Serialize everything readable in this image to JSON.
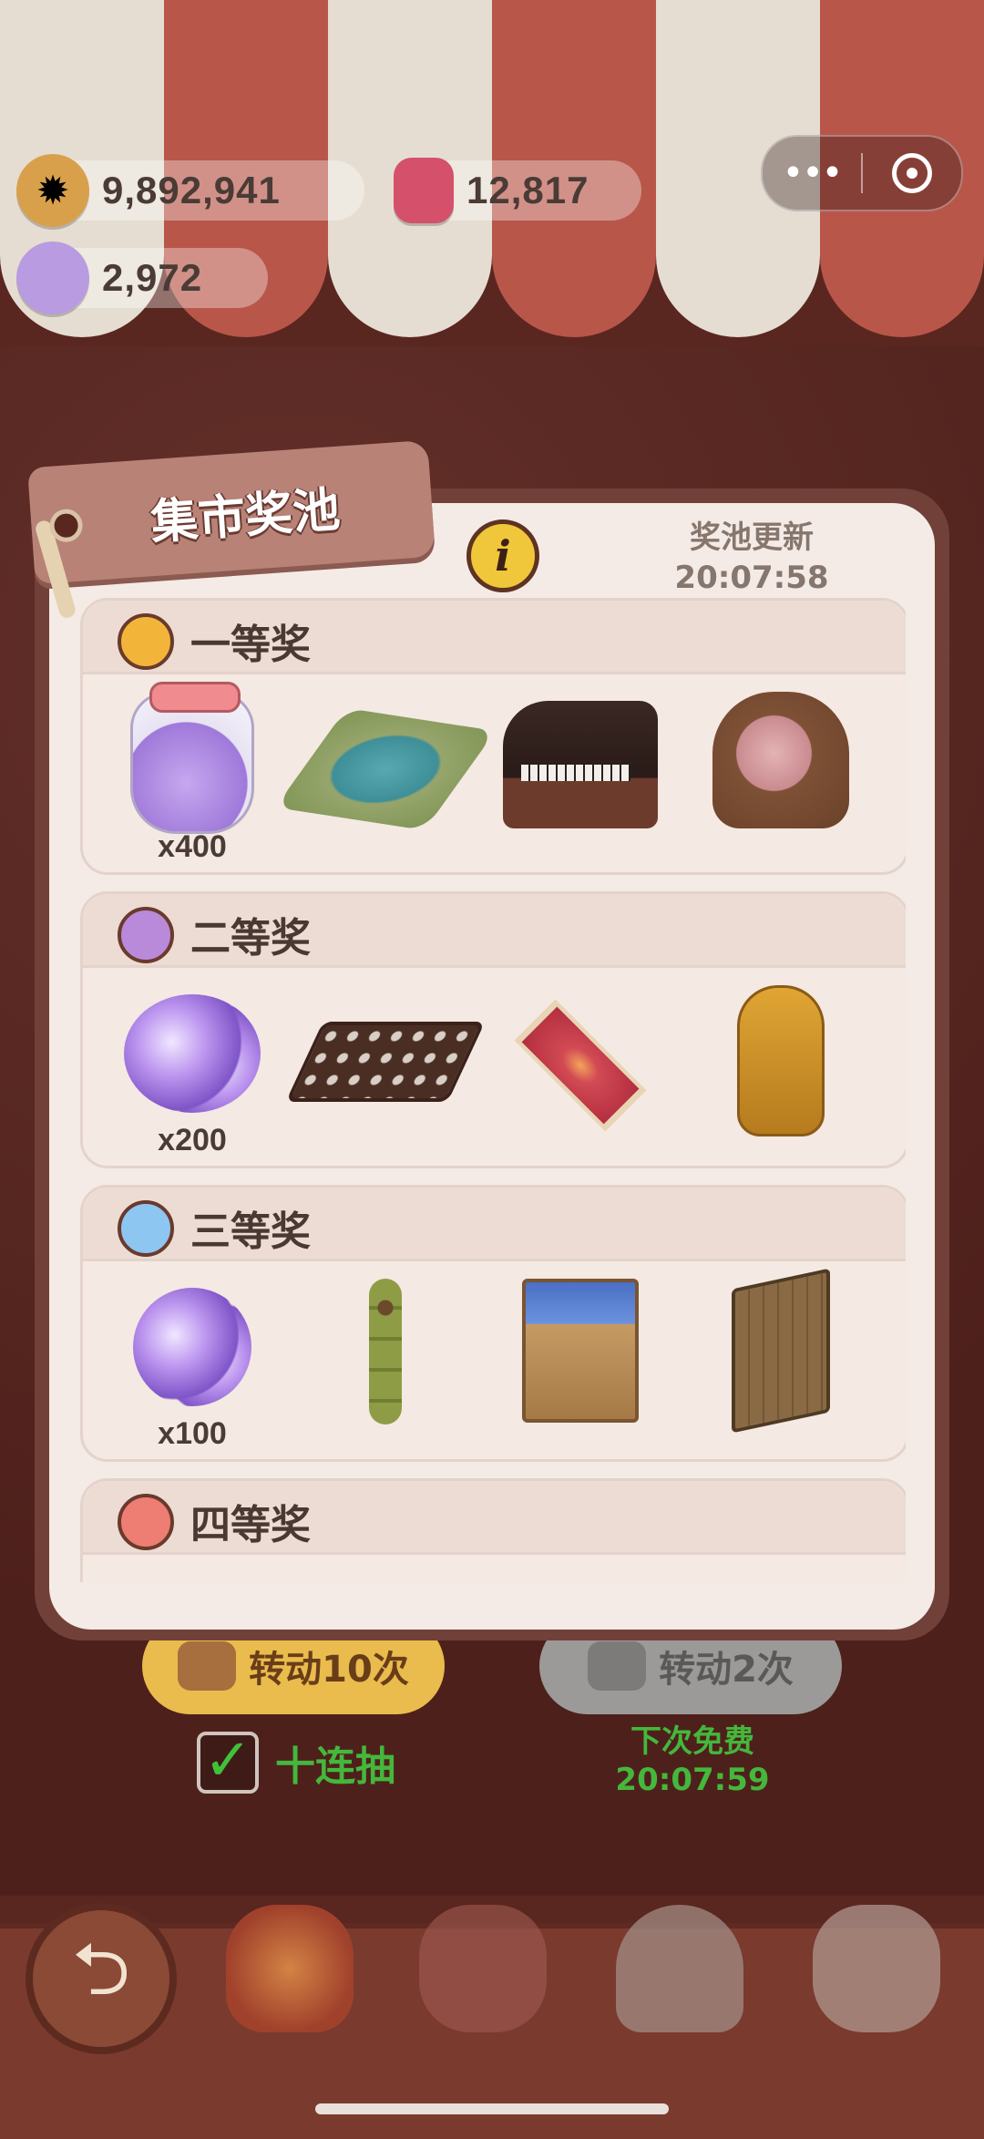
{
  "currencies": {
    "cookies": "9,892,941",
    "jam": "12,817",
    "candy": "2,972"
  },
  "capsule": {
    "more_icon": "more-dots-icon",
    "close_icon": "target-circle-icon"
  },
  "panel": {
    "title": "集市奖池",
    "refresh_label": "奖池更新",
    "refresh_time": "20:07:58",
    "info_symbol": "i"
  },
  "tiers": [
    {
      "name": "一等奖",
      "ball_color": "#f2b53a",
      "items": [
        {
          "type": "candy-jar",
          "qty": "x400"
        },
        {
          "type": "pond"
        },
        {
          "type": "grand-piano"
        },
        {
          "type": "carved-chair"
        }
      ]
    },
    {
      "name": "二等奖",
      "ball_color": "#b88ad9",
      "items": [
        {
          "type": "candy-pile",
          "qty": "x200"
        },
        {
          "type": "chocolate-bar"
        },
        {
          "type": "red-rug"
        },
        {
          "type": "pharaoh-sarcophagus"
        }
      ]
    },
    {
      "name": "三等奖",
      "ball_color": "#8ec6f2",
      "items": [
        {
          "type": "candy-few",
          "qty": "x100"
        },
        {
          "type": "dango-skewer"
        },
        {
          "type": "curtain-door"
        },
        {
          "type": "wooden-door"
        }
      ]
    },
    {
      "name": "四等奖",
      "ball_color": "#ee7d73",
      "items": []
    }
  ],
  "controls": {
    "spin10_label": "转动10次",
    "spin2_label": "转动2次",
    "ten_draw_label": "十连抽",
    "ten_draw_checked": true,
    "next_free_label": "下次免费",
    "next_free_time": "20:07:59"
  },
  "colors": {
    "accent_green": "#44b73c",
    "panel_border": "#714139",
    "gold_button": "#e9bc4d"
  }
}
